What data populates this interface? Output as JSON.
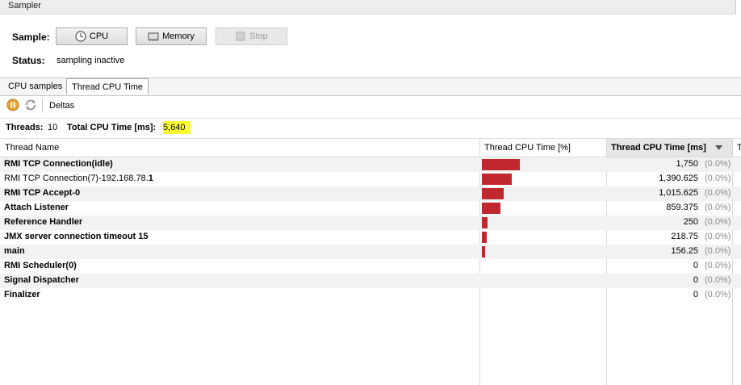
{
  "window": {
    "title": "Sampler"
  },
  "sample": {
    "label": "Sample:",
    "cpu_label": "CPU",
    "memory_label": "Memory",
    "stop_label": "Stop"
  },
  "status": {
    "label": "Status:",
    "value": "sampling inactive"
  },
  "tabs": [
    {
      "label": "CPU samples",
      "active": false
    },
    {
      "label": "Thread CPU Time",
      "active": true
    }
  ],
  "toolbar": {
    "deltas_label": "Deltas"
  },
  "summary": {
    "threads_label": "Threads:",
    "threads_value": "10",
    "total_label": "Total CPU Time [ms]:",
    "total_value": "5,640"
  },
  "table": {
    "columns": [
      "Thread Name",
      "Thread CPU Time [%]",
      "Thread CPU Time [ms]",
      "T"
    ],
    "sorted_column": "Thread CPU Time [ms]",
    "sort_direction": "descending",
    "rows": [
      {
        "name": "RMI TCP Connection(idle)",
        "bold": true,
        "ms": "1,750",
        "pct": "(0.0%)",
        "bar_fraction": 1.0
      },
      {
        "name_prefix": "RMI TCP Connection(7)-192.168.78.",
        "name_suffix": "1",
        "bold": false,
        "ms": "1,390.625",
        "pct": "(0.0%)",
        "bar_fraction": 0.795
      },
      {
        "name": "RMI TCP Accept-0",
        "bold": true,
        "ms": "1,015.625",
        "pct": "(0.0%)",
        "bar_fraction": 0.58
      },
      {
        "name": "Attach Listener",
        "bold": true,
        "ms": "859.375",
        "pct": "(0.0%)",
        "bar_fraction": 0.491
      },
      {
        "name": "Reference Handler",
        "bold": true,
        "ms": "250",
        "pct": "(0.0%)",
        "bar_fraction": 0.143
      },
      {
        "name": "JMX server connection timeout 15",
        "bold": true,
        "ms": "218.75",
        "pct": "(0.0%)",
        "bar_fraction": 0.125
      },
      {
        "name": "main",
        "bold": true,
        "ms": "156.25",
        "pct": "(0.0%)",
        "bar_fraction": 0.089
      },
      {
        "name": "RMI Scheduler(0)",
        "bold": true,
        "ms": "0",
        "pct": "(0.0%)",
        "bar_fraction": 0
      },
      {
        "name": "Signal Dispatcher",
        "bold": true,
        "ms": "0",
        "pct": "(0.0%)",
        "bar_fraction": 0
      },
      {
        "name": "Finalizer",
        "bold": true,
        "ms": "0",
        "pct": "(0.0%)",
        "bar_fraction": 0
      }
    ]
  },
  "colors": {
    "bar": "#c0282e",
    "highlight": "#ffff33",
    "pause_icon": "#e8a33a"
  }
}
